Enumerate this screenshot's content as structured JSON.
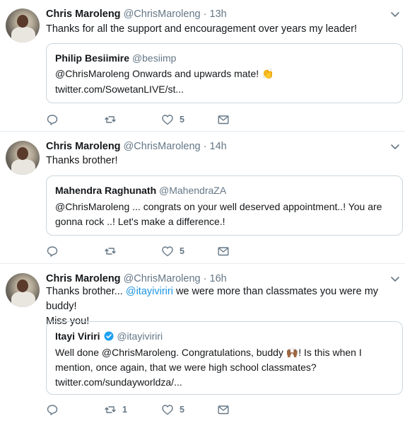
{
  "tweets": [
    {
      "name": "Chris Maroleng",
      "handle": "@ChrisMaroleng",
      "sep": "·",
      "time": "13h",
      "text": "Thanks for all the support and encouragement over years my leader!",
      "quote": {
        "name": "Philip Besiimire",
        "handle": "@besiimp",
        "line1": "@ChrisMaroleng Onwards and upwards mate! 👏",
        "line2": "twitter.com/SowetanLIVE/st..."
      },
      "actions": {
        "reply_count": "",
        "retweet_count": "",
        "like_count": "5"
      }
    },
    {
      "name": "Chris Maroleng",
      "handle": "@ChrisMaroleng",
      "sep": "·",
      "time": "14h",
      "text": "Thanks brother!",
      "quote": {
        "name": "Mahendra Raghunath",
        "handle": "@MahendraZA",
        "line1": "@ChrisMaroleng ... congrats on your well deserved appointment..! You are",
        "line2": "gonna rock ..! Let's make a difference.!"
      },
      "actions": {
        "reply_count": "",
        "retweet_count": "",
        "like_count": "5"
      }
    },
    {
      "name": "Chris Maroleng",
      "handle": "@ChrisMaroleng",
      "sep": "·",
      "time": "16h",
      "text_pre": "Thanks brother... ",
      "text_mention": "@itayiviriri",
      "text_post": " we were more than classmates you were my buddy!",
      "text_line2": "Miss you!",
      "quote": {
        "name": "Itayi Viriri",
        "handle": "@itayiviriri",
        "line1": "Well done @ChrisMaroleng. Congratulations, buddy 🙌🏾! Is this when I",
        "line2": "mention, once again, that we were high school classmates?",
        "line3": "twitter.com/sundayworldza/..."
      },
      "actions": {
        "reply_count": "",
        "retweet_count": "1",
        "like_count": "5"
      }
    }
  ],
  "icons": {
    "reply": "reply-icon",
    "retweet": "retweet-icon",
    "like": "heart-icon",
    "dm": "envelope-icon",
    "caret": "chevron-down-icon",
    "verified": "verified-badge-icon"
  },
  "colors": {
    "link": "#1b95e0",
    "muted": "#657786",
    "border": "#ccd6dd",
    "verified": "#1da1f2"
  }
}
